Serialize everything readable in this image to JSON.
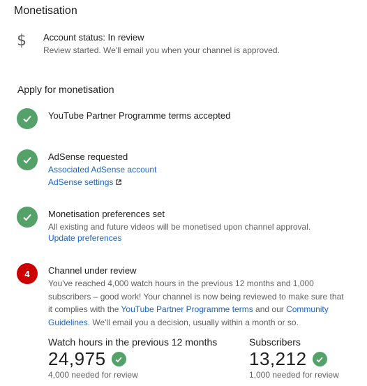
{
  "page": {
    "title": "Monetisation"
  },
  "status": {
    "icon": "dollar-icon",
    "title": "Account status: In review",
    "subtitle": "Review started. We'll email you when your channel is approved."
  },
  "apply": {
    "title": "Apply for monetisation",
    "steps": [
      {
        "state": "done",
        "icon": "check-icon",
        "title": "YouTube Partner Programme terms accepted"
      },
      {
        "state": "done",
        "icon": "check-icon",
        "title": "AdSense requested",
        "links": [
          "Associated AdSense account",
          "AdSense settings"
        ]
      },
      {
        "state": "done",
        "icon": "check-icon",
        "title": "Monetisation preferences set",
        "description": "All existing and future videos will be monetised upon channel approval.",
        "link": "Update preferences"
      },
      {
        "state": "current",
        "number": "4",
        "title": "Channel under review",
        "text_1": "You've reached 4,000 watch hours in the previous 12 months and 1,000 subscribers – good work! Your channel is now being reviewed to make sure that it complies with the ",
        "link_1": "YouTube Partner Programme terms",
        "text_2": " and our ",
        "link_2": "Community Guidelines",
        "text_3": ". We'll email you a decision, usually within a month or so."
      }
    ]
  },
  "stats": [
    {
      "label": "Watch hours in the previous 12 months",
      "value": "24,975",
      "requirement": "4,000 needed for review"
    },
    {
      "label": "Subscribers",
      "value": "13,212",
      "requirement": "1,000 needed for review"
    }
  ],
  "colors": {
    "success": "#55a16a",
    "current": "#cc0000",
    "link": "#1a65c8",
    "secondary_text": "#606060"
  }
}
